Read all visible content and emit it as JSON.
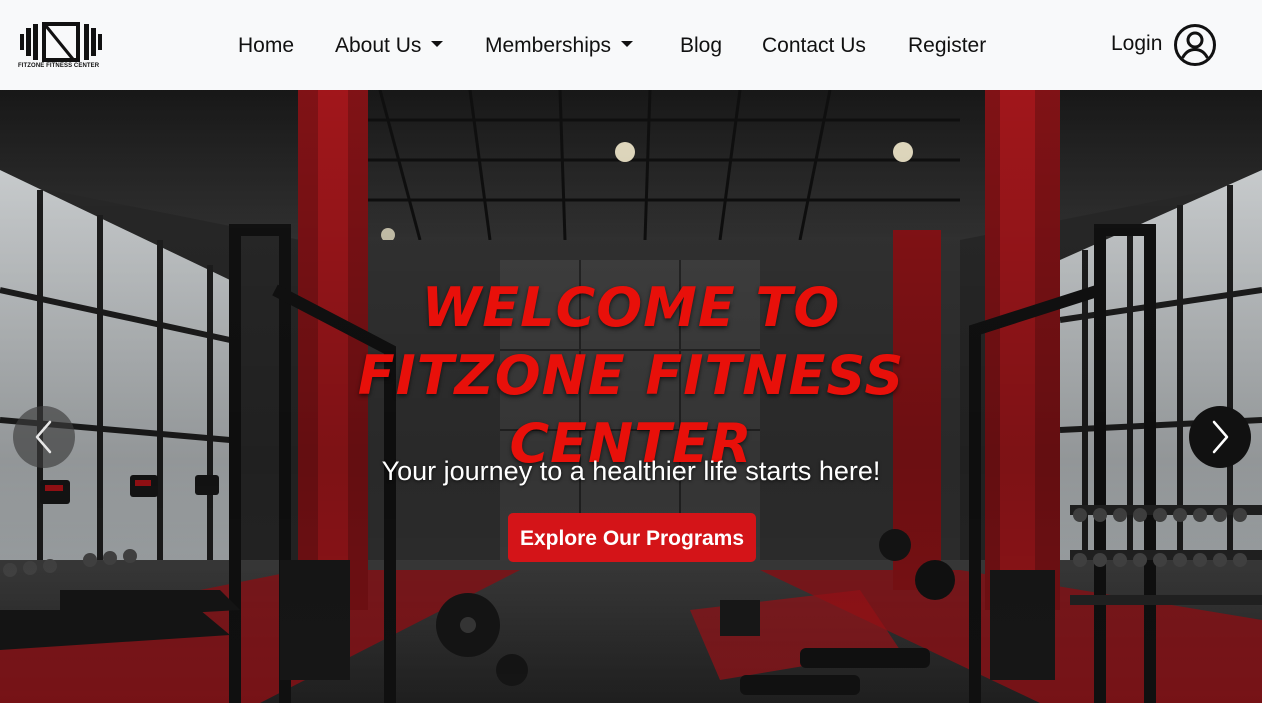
{
  "brand": {
    "name": "FITZONE FITNESS CENTER",
    "logo_icon": "fz-dumbbell-logo-icon"
  },
  "nav": {
    "items": [
      {
        "label": "Home",
        "dropdown": false
      },
      {
        "label": "About Us",
        "dropdown": true
      },
      {
        "label": "Memberships",
        "dropdown": true
      },
      {
        "label": "Blog",
        "dropdown": false
      },
      {
        "label": "Contact Us",
        "dropdown": false
      },
      {
        "label": "Register",
        "dropdown": false
      }
    ],
    "login_label": "Login",
    "login_icon": "user-circle-icon"
  },
  "hero": {
    "title_lines": [
      "WELCOME TO",
      "FITZONE FITNESS",
      "CENTER"
    ],
    "subtitle": "Your journey to a healthier life starts here!",
    "cta_label": "Explore Our Programs",
    "prev_icon": "chevron-left-icon",
    "next_icon": "chevron-right-icon"
  },
  "colors": {
    "navbar_bg": "#f8f9fa",
    "title_red": "#e8100a",
    "cta_red": "#d41418",
    "accent_gym_red": "#b0141a"
  }
}
